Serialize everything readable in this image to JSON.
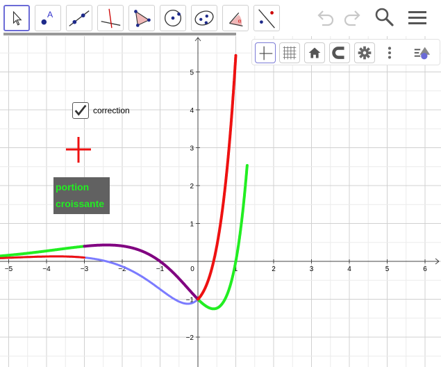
{
  "toolbar": {
    "tools": [
      {
        "name": "move-tool",
        "icon": "arrow-cursor-icon",
        "active": true
      },
      {
        "name": "point-tool",
        "icon": "point-a-icon"
      },
      {
        "name": "line-tool",
        "icon": "line-through-points-icon"
      },
      {
        "name": "perpendicular-tool",
        "icon": "perpendicular-line-icon"
      },
      {
        "name": "polygon-tool",
        "icon": "polygon-icon"
      },
      {
        "name": "circle-tool",
        "icon": "circle-center-point-icon"
      },
      {
        "name": "conic-tool",
        "icon": "ellipse-icon"
      },
      {
        "name": "angle-tool",
        "icon": "angle-icon"
      },
      {
        "name": "reflect-tool",
        "icon": "reflect-point-icon"
      }
    ],
    "right_icons": [
      "undo-icon",
      "redo-icon",
      "search-icon",
      "menu-icon"
    ]
  },
  "style_bar": {
    "buttons": [
      "axes-icon",
      "grid-icon",
      "home-icon",
      "magnet-icon",
      "gear-icon",
      "more-vert-icon",
      "style-bar-toggle-icon"
    ]
  },
  "checkbox": {
    "label": "correction",
    "checked": true
  },
  "text_box": {
    "line1": "portion",
    "line2": "croissante"
  },
  "axes": {
    "x_ticks": [
      "−5",
      "−4",
      "−3",
      "−2",
      "−1",
      "0",
      "1",
      "2",
      "3",
      "4",
      "5",
      "6"
    ],
    "y_ticks": [
      "5",
      "4",
      "3",
      "2",
      "1",
      "−1",
      "−2"
    ]
  },
  "colors": {
    "red": "#ee1111",
    "green": "#22ee22",
    "purple": "#800080",
    "light_blue": "#7b7bff",
    "accent": "#6b6bd6"
  }
}
